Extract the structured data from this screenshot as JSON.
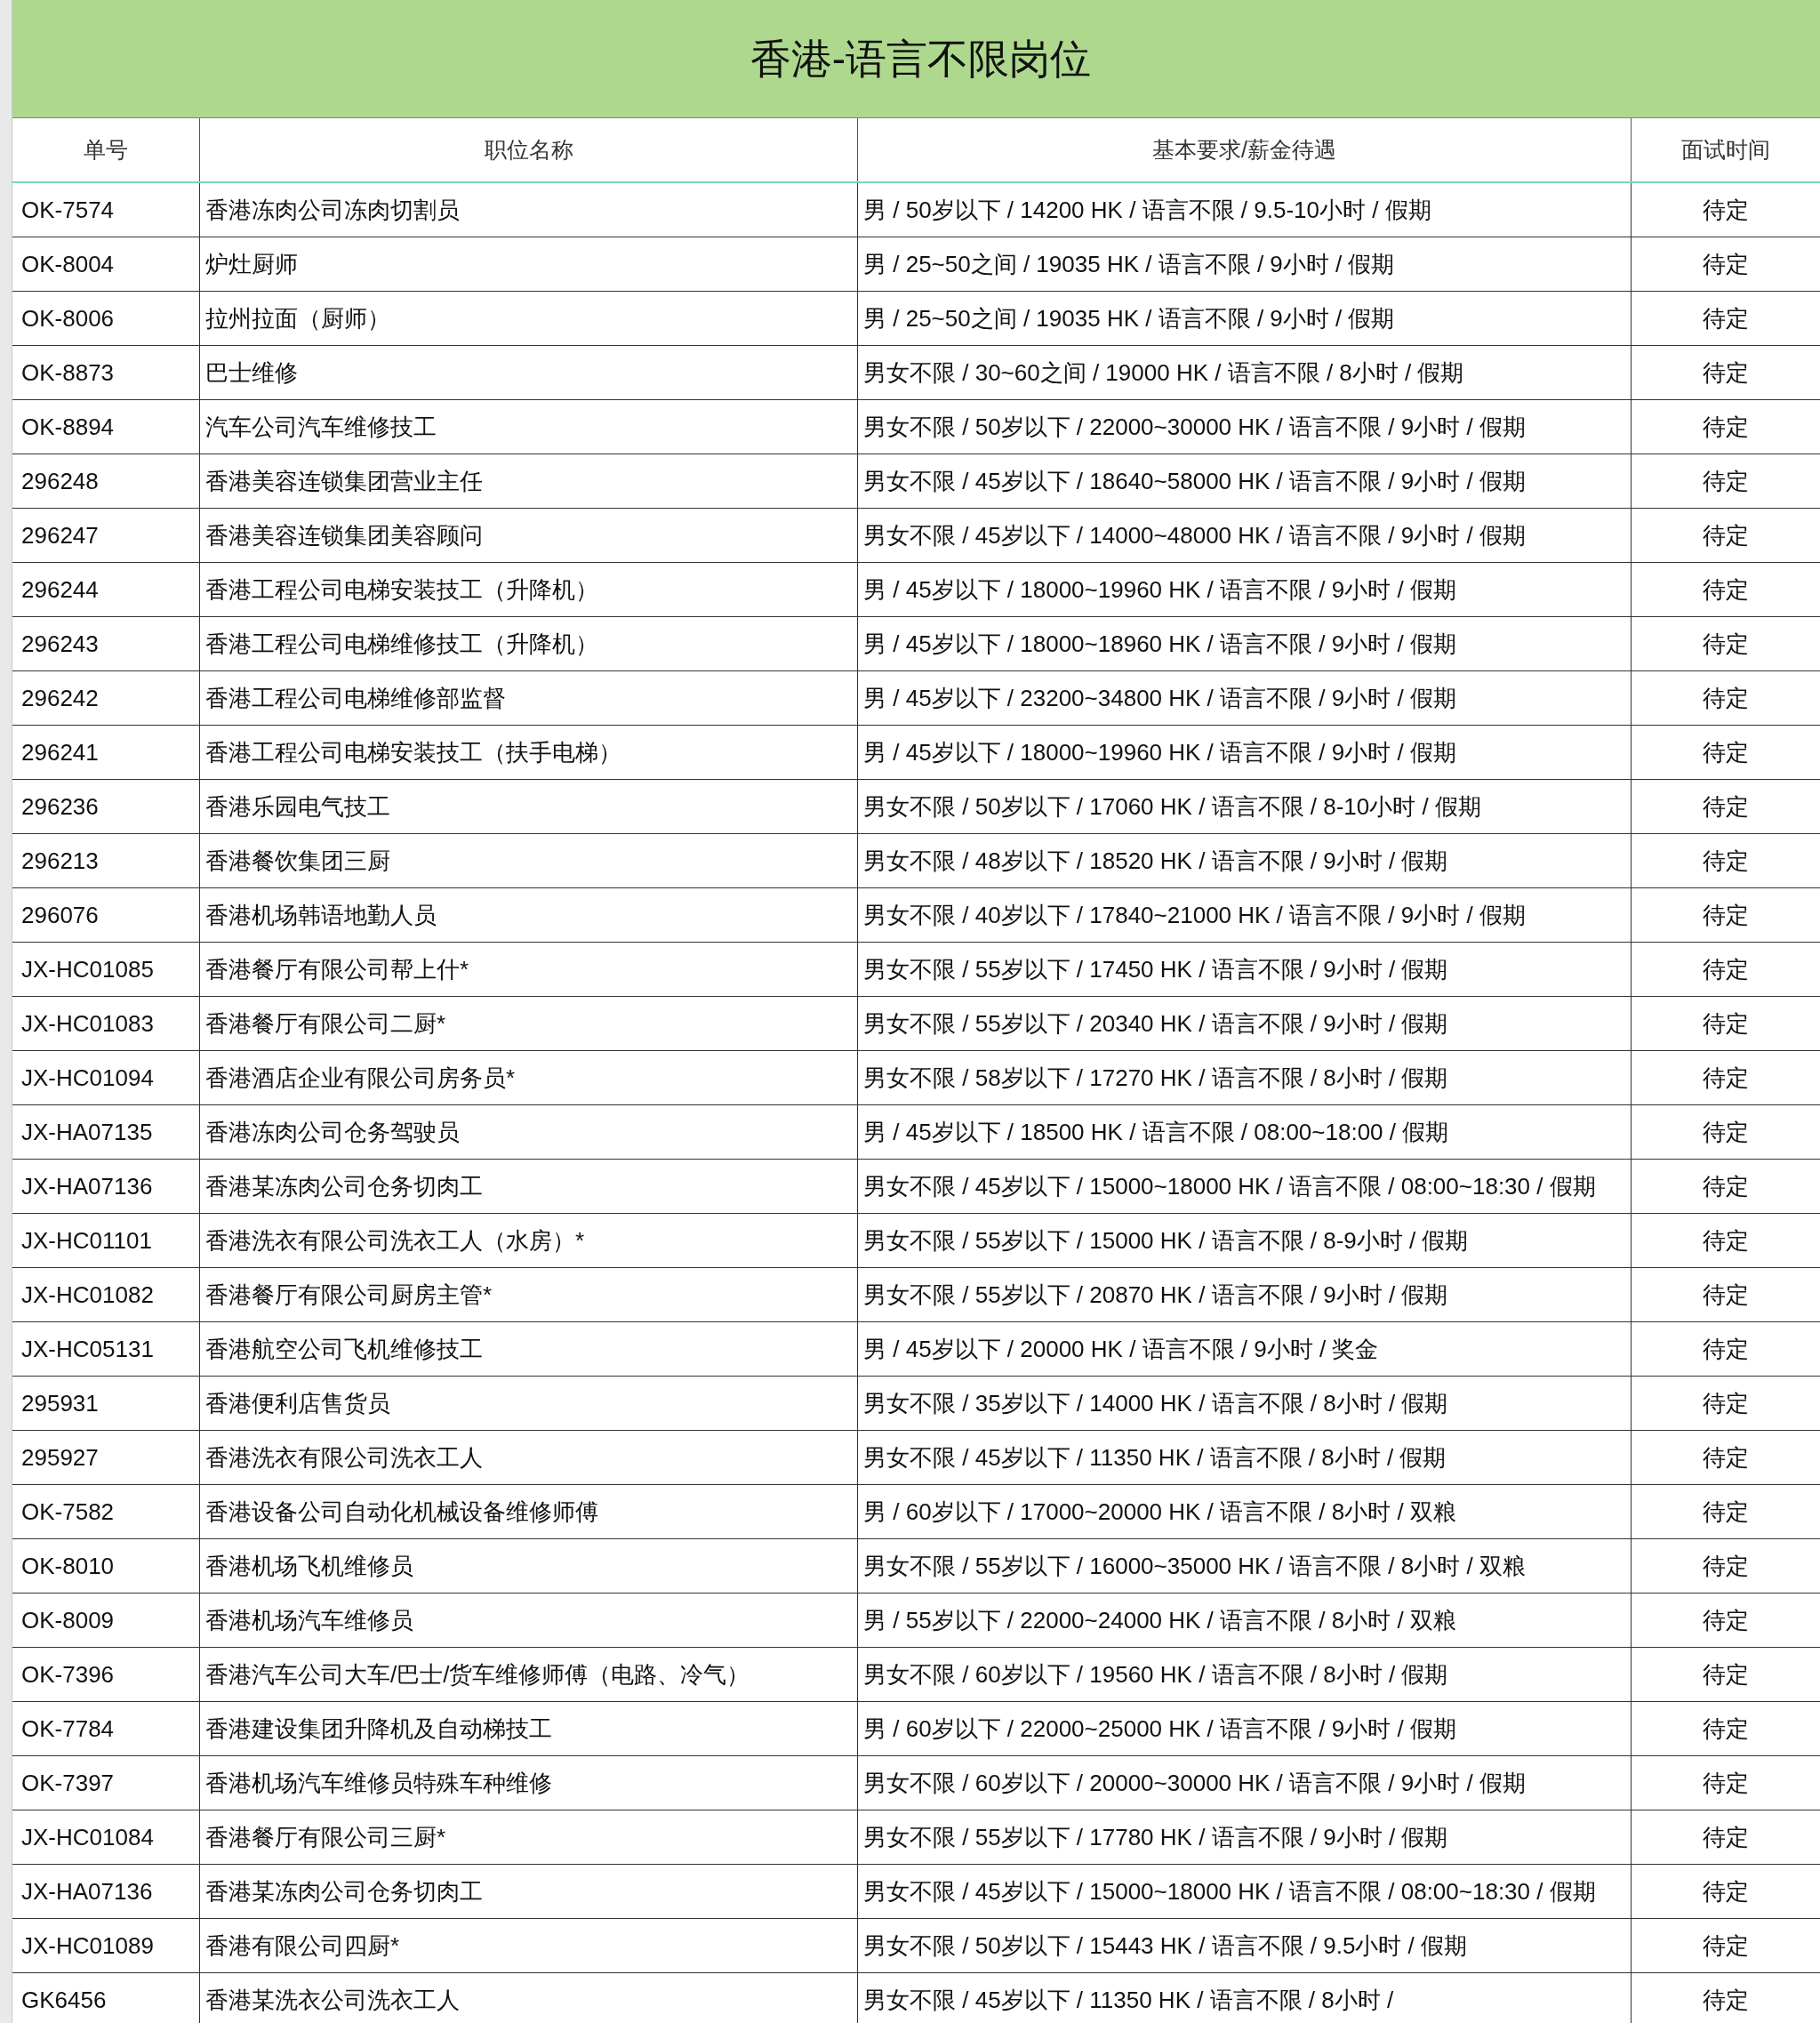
{
  "title": "香港-语言不限岗位",
  "table": {
    "columns": [
      "单号",
      "职位名称",
      "基本要求/薪金待遇",
      "面试时间"
    ],
    "rows": [
      [
        "OK-7574",
        "香港冻肉公司冻肉切割员",
        "男 / 50岁以下 / 14200 HK / 语言不限 / 9.5-10小时 / 假期",
        "待定"
      ],
      [
        "OK-8004",
        "炉灶厨师",
        "男 / 25~50之间 / 19035 HK / 语言不限 / 9小时 / 假期",
        "待定"
      ],
      [
        "OK-8006",
        "拉州拉面（厨师）",
        "男 / 25~50之间 / 19035 HK / 语言不限 / 9小时 / 假期",
        "待定"
      ],
      [
        "OK-8873",
        "巴士维修",
        "男女不限 / 30~60之间 / 19000 HK / 语言不限 / 8小时 / 假期",
        "待定"
      ],
      [
        "OK-8894",
        "汽车公司汽车维修技工",
        "男女不限 / 50岁以下 / 22000~30000 HK / 语言不限 / 9小时 / 假期",
        "待定"
      ],
      [
        "296248",
        "香港美容连锁集团营业主任",
        "男女不限 / 45岁以下 / 18640~58000 HK / 语言不限 / 9小时 / 假期",
        "待定"
      ],
      [
        "296247",
        "香港美容连锁集团美容顾问",
        "男女不限 / 45岁以下 / 14000~48000 HK / 语言不限 / 9小时 / 假期",
        "待定"
      ],
      [
        "296244",
        "香港工程公司电梯安装技工（升降机）",
        "男 / 45岁以下 / 18000~19960 HK / 语言不限 / 9小时 / 假期",
        "待定"
      ],
      [
        "296243",
        "香港工程公司电梯维修技工（升降机）",
        "男 / 45岁以下 / 18000~18960 HK / 语言不限 / 9小时 / 假期",
        "待定"
      ],
      [
        "296242",
        "香港工程公司电梯维修部监督",
        "男 / 45岁以下 / 23200~34800 HK / 语言不限 / 9小时 / 假期",
        "待定"
      ],
      [
        "296241",
        "香港工程公司电梯安装技工（扶手电梯）",
        "男 / 45岁以下 / 18000~19960 HK / 语言不限 / 9小时 / 假期",
        "待定"
      ],
      [
        "296236",
        "香港乐园电气技工",
        "男女不限 / 50岁以下 / 17060 HK / 语言不限 / 8-10小时 / 假期",
        "待定"
      ],
      [
        "296213",
        "香港餐饮集团三厨",
        "男女不限 / 48岁以下 / 18520 HK / 语言不限 / 9小时 / 假期",
        "待定"
      ],
      [
        "296076",
        "香港机场韩语地勤人员",
        "男女不限 / 40岁以下 / 17840~21000 HK / 语言不限 / 9小时 / 假期",
        "待定"
      ],
      [
        "JX-HC01085",
        "香港餐厅有限公司帮上什*",
        "男女不限 / 55岁以下 / 17450 HK / 语言不限 / 9小时 / 假期",
        "待定"
      ],
      [
        "JX-HC01083",
        "香港餐厅有限公司二厨*",
        "男女不限 / 55岁以下 / 20340 HK / 语言不限 / 9小时 / 假期",
        "待定"
      ],
      [
        "JX-HC01094",
        "香港酒店企业有限公司房务员*",
        "男女不限 / 58岁以下 / 17270 HK / 语言不限 / 8小时 / 假期",
        "待定"
      ],
      [
        "JX-HA07135",
        "香港冻肉公司仓务驾驶员",
        "男 / 45岁以下 / 18500 HK / 语言不限 / 08:00~18:00 / 假期",
        "待定"
      ],
      [
        "JX-HA07136",
        "香港某冻肉公司仓务切肉工",
        "男女不限 / 45岁以下 / 15000~18000 HK / 语言不限 / 08:00~18:30 / 假期",
        "待定"
      ],
      [
        "JX-HC01101",
        "香港洗衣有限公司洗衣工人（水房）*",
        "男女不限 / 55岁以下 / 15000 HK / 语言不限 / 8-9小时 / 假期",
        "待定"
      ],
      [
        "JX-HC01082",
        "香港餐厅有限公司厨房主管*",
        "男女不限 / 55岁以下 / 20870 HK / 语言不限 / 9小时 / 假期",
        "待定"
      ],
      [
        "JX-HC05131",
        "香港航空公司飞机维修技工",
        "男 / 45岁以下 / 20000 HK / 语言不限 / 9小时 / 奖金",
        "待定"
      ],
      [
        "295931",
        "香港便利店售货员",
        "男女不限 / 35岁以下 / 14000 HK / 语言不限 / 8小时 / 假期",
        "待定"
      ],
      [
        "295927",
        "香港洗衣有限公司洗衣工人",
        "男女不限 / 45岁以下 / 11350 HK / 语言不限 / 8小时 / 假期",
        "待定"
      ],
      [
        "OK-7582",
        "香港设备公司自动化机械设备维修师傅",
        "男 / 60岁以下 / 17000~20000 HK / 语言不限 / 8小时 / 双粮",
        "待定"
      ],
      [
        "OK-8010",
        "香港机场飞机维修员",
        "男女不限 / 55岁以下 / 16000~35000 HK / 语言不限 / 8小时 / 双粮",
        "待定"
      ],
      [
        "OK-8009",
        "香港机场汽车维修员",
        "男 / 55岁以下 / 22000~24000 HK / 语言不限 / 8小时 / 双粮",
        "待定"
      ],
      [
        "OK-7396",
        "香港汽车公司大车/巴士/货车维修师傅（电路、冷气）",
        "男女不限 / 60岁以下 / 19560 HK / 语言不限 / 8小时 / 假期",
        "待定"
      ],
      [
        "OK-7784",
        "香港建设集团升降机及自动梯技工",
        "男 / 60岁以下 / 22000~25000 HK / 语言不限 / 9小时 / 假期",
        "待定"
      ],
      [
        "OK-7397",
        "香港机场汽车维修员特殊车种维修",
        "男女不限 / 60岁以下 / 20000~30000 HK / 语言不限 / 9小时 / 假期",
        "待定"
      ],
      [
        "JX-HC01084",
        "香港餐厅有限公司三厨*",
        "男女不限 / 55岁以下 / 17780 HK / 语言不限 / 9小时 / 假期",
        "待定"
      ],
      [
        "JX-HA07136",
        "香港某冻肉公司仓务切肉工",
        "男女不限 / 45岁以下 / 15000~18000 HK / 语言不限 / 08:00~18:30 / 假期",
        "待定"
      ],
      [
        "JX-HC01089",
        "香港有限公司四厨*",
        "男女不限 / 50岁以下 / 15443 HK / 语言不限 / 9.5小时 / 假期",
        "待定"
      ],
      [
        "GK6456",
        "香港某洗衣公司洗衣工人",
        "男女不限 / 45岁以下 / 11350 HK / 语言不限 / 8小时 /",
        "待定"
      ]
    ]
  }
}
